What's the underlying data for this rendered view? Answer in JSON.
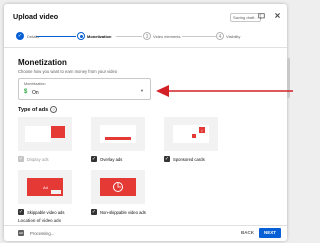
{
  "header": {
    "title": "Upload video",
    "saving_text": "Saving draft...",
    "feedback_icon": "feedback-icon",
    "close_icon": "close-icon"
  },
  "stepper": {
    "steps": [
      {
        "label": "Details",
        "state": "done",
        "number": "✓"
      },
      {
        "label": "Monetization",
        "state": "current",
        "number": ""
      },
      {
        "label": "Video elements",
        "state": "todo",
        "number": "3"
      },
      {
        "label": "Visibility",
        "state": "todo",
        "number": "4"
      }
    ]
  },
  "monetization": {
    "title": "Monetization",
    "subtitle": "Choose how you want to earn money from your video",
    "select_label": "Monetization",
    "select_value": "On",
    "dollar_icon": "$"
  },
  "ads": {
    "title": "Type of ads",
    "help_icon": "?",
    "items": [
      {
        "label": "Display ads",
        "checked": true,
        "disabled": true
      },
      {
        "label": "Overlay ads",
        "checked": true,
        "disabled": false
      },
      {
        "label": "Sponsored cards",
        "checked": true,
        "disabled": false
      },
      {
        "label": "Skippable video ads",
        "checked": true,
        "disabled": false
      },
      {
        "label": "Non-skippable video ads",
        "checked": true,
        "disabled": false
      }
    ],
    "next_section_label": "Location of video ads"
  },
  "footer": {
    "hd_badge": "HD",
    "status": "Processing...",
    "back_label": "BACK",
    "next_label": "NEXT"
  },
  "colors": {
    "accent": "#065fd4",
    "arrow": "#d32027",
    "ad_red": "#e53935",
    "money_green": "#2ba640"
  }
}
